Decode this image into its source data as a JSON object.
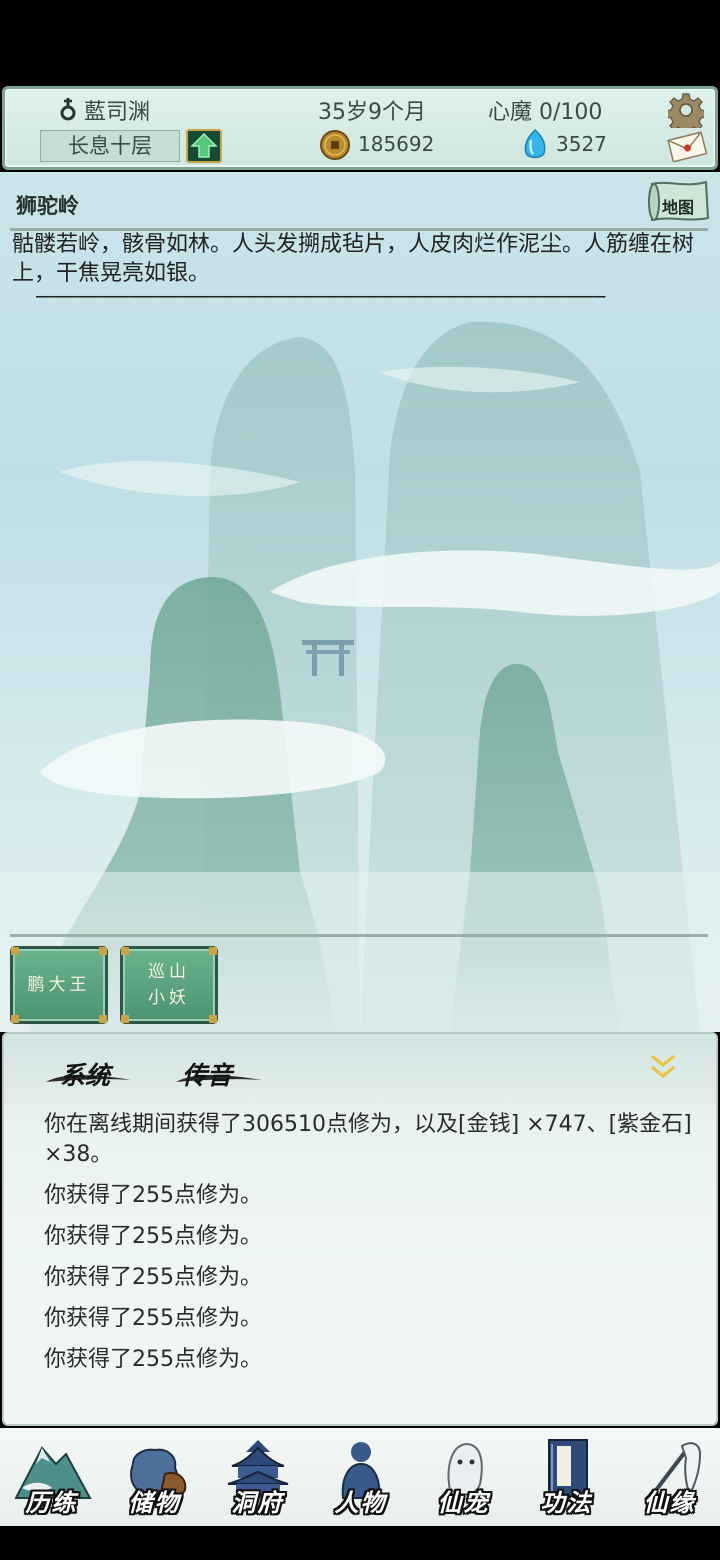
{
  "header": {
    "player_name": "藍司渊",
    "realm": "长息十层",
    "age": "35岁9个月",
    "heart_demon": "心魔  0/100",
    "coins": "185692",
    "spirit_stones": "3527"
  },
  "scene": {
    "location": "狮驼岭",
    "map_label": "地图",
    "description": "骷髅若岭，骸骨如林。人头发搠成毡片，人皮肉烂作泥尘。人筋缠在树上，干焦晃亮如银。",
    "divider": "———————————————————————————————————————————",
    "npcs": [
      {
        "label": "鹏大王"
      },
      {
        "label": "巡山\n小妖"
      }
    ]
  },
  "log": {
    "tabs": [
      "系统",
      "传音"
    ],
    "lines": [
      "你在离线期间获得了306510点修为，以及[金钱] ×747、[紫金石] ×38。",
      "你获得了255点修为。",
      "你获得了255点修为。",
      "你获得了255点修为。",
      "你获得了255点修为。",
      "你获得了255点修为。"
    ]
  },
  "nav": {
    "items": [
      {
        "label": "历练",
        "icon": "mountain-icon"
      },
      {
        "label": "储物",
        "icon": "pouch-icon"
      },
      {
        "label": "洞府",
        "icon": "pavilion-icon"
      },
      {
        "label": "人物",
        "icon": "person-icon"
      },
      {
        "label": "仙宠",
        "icon": "ghost-pet-icon"
      },
      {
        "label": "功法",
        "icon": "scroll-book-icon"
      },
      {
        "label": "仙缘",
        "icon": "crane-icon"
      }
    ]
  },
  "colors": {
    "panel_border": "#7da58f",
    "npc_button": "#4c9470",
    "scene_sky": "#cbe4ea"
  }
}
